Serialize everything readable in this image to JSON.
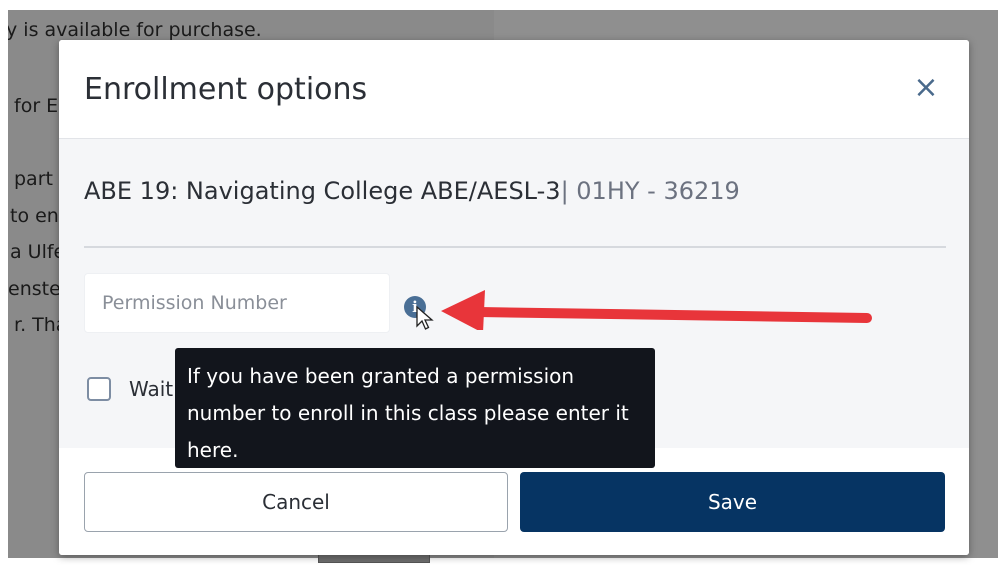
{
  "background": {
    "lines": [
      "y is available for purchase.",
      "for E",
      "part",
      "to en",
      "a Ulfe",
      "enste",
      "r. Tha"
    ]
  },
  "modal": {
    "title": "Enrollment options",
    "close_icon": "close-icon",
    "course_main": "ABE 19: Navigating College ABE/AESL-3",
    "course_sub": "| 01HY - 36219",
    "permission_placeholder": "Permission Number",
    "info_icon": "info-icon",
    "checkbox_label": "Wait",
    "tooltip": "If you have been granted a permission number to enroll in this class please enter it here.",
    "cancel_label": "Cancel",
    "save_label": "Save"
  },
  "colors": {
    "primary": "#063463",
    "annotation_arrow": "#e8353a",
    "tooltip_bg": "#12151c"
  }
}
